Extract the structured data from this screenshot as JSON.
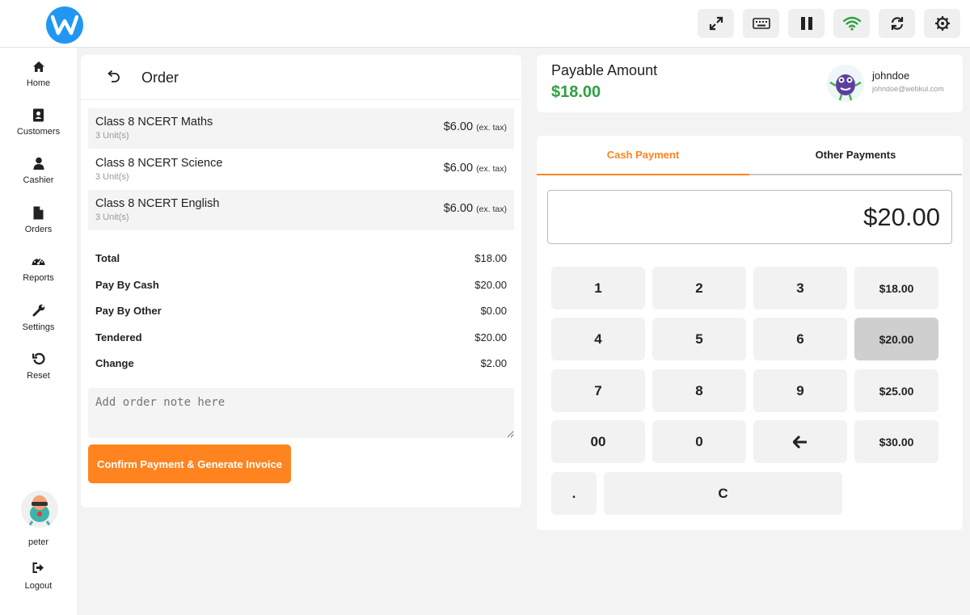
{
  "sidebar": {
    "items": [
      {
        "label": "Home",
        "icon": "home-icon"
      },
      {
        "label": "Customers",
        "icon": "contacts-icon"
      },
      {
        "label": "Cashier",
        "icon": "user-icon"
      },
      {
        "label": "Orders",
        "icon": "file-icon"
      },
      {
        "label": "Reports",
        "icon": "dashboard-icon"
      },
      {
        "label": "Settings",
        "icon": "wrench-icon"
      },
      {
        "label": "Reset",
        "icon": "reset-icon"
      }
    ],
    "user": {
      "name": "peter"
    },
    "logout_label": "Logout"
  },
  "topbar": {
    "buttons": [
      "expand-icon",
      "keyboard-icon",
      "pause-icon",
      "wifi-icon",
      "sync-icon",
      "gear-icon"
    ],
    "wifi_color": "#2ea043"
  },
  "order": {
    "title": "Order",
    "items": [
      {
        "name": "Class 8 NCERT Maths",
        "units": "3 Unit(s)",
        "price": "$6.00",
        "tax_note": "(ex. tax)"
      },
      {
        "name": "Class 8 NCERT Science",
        "units": "3 Unit(s)",
        "price": "$6.00",
        "tax_note": "(ex. tax)"
      },
      {
        "name": "Class 8 NCERT English",
        "units": "3 Unit(s)",
        "price": "$6.00",
        "tax_note": "(ex. tax)"
      }
    ],
    "summary": [
      {
        "label": "Total",
        "value": "$18.00"
      },
      {
        "label": "Pay By Cash",
        "value": "$20.00"
      },
      {
        "label": "Pay By Other",
        "value": "$0.00"
      },
      {
        "label": "Tendered",
        "value": "$20.00"
      },
      {
        "label": "Change",
        "value": "$2.00"
      }
    ],
    "note_placeholder": "Add order note here",
    "confirm_label": "Confirm Payment & Generate Invoice"
  },
  "payable": {
    "label": "Payable Amount",
    "amount": "$18.00",
    "amount_color": "#2ea043",
    "customer_name": "johndoe",
    "customer_email": "johndoe@webkul.com"
  },
  "payment": {
    "tabs": [
      "Cash Payment",
      "Other Payments"
    ],
    "active_tab": "Cash Payment",
    "accent": "#ff8420",
    "entered_amount": "$20.00",
    "keys": [
      "1",
      "2",
      "3",
      "4",
      "5",
      "6",
      "7",
      "8",
      "9",
      "00",
      "0",
      "←",
      ".",
      "C"
    ],
    "quick_amounts": [
      "$18.00",
      "$20.00",
      "$25.00",
      "$30.00"
    ],
    "selected_quick_amount": "$20.00"
  }
}
